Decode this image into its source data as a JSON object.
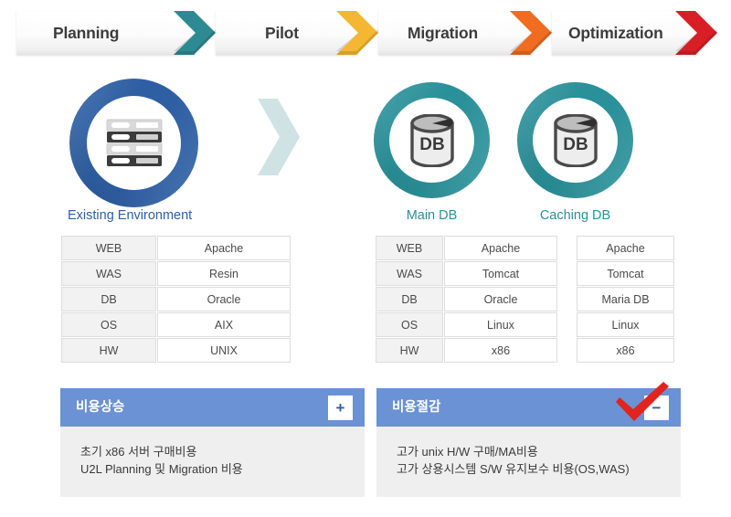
{
  "phases": [
    {
      "label": "Planning",
      "arrow_color": "#2e8a92"
    },
    {
      "label": "Pilot",
      "arrow_color": "#f5b731"
    },
    {
      "label": "Migration",
      "arrow_color": "#ef6c20"
    },
    {
      "label": "Optimization",
      "arrow_color": "#d81f26"
    }
  ],
  "nodes": {
    "existing": {
      "caption": "Existing Environment",
      "icon": "server-rack-icon",
      "ring_color": "#2e5fa3"
    },
    "main_db": {
      "caption": "Main DB",
      "icon": "database-icon",
      "badge_text": "DB",
      "ring_color": "#2a9099"
    },
    "caching_db": {
      "caption": "Caching DB",
      "icon": "database-icon",
      "badge_text": "DB",
      "ring_color": "#2a9099"
    }
  },
  "flow_arrow_icon": "chevron-right-icon",
  "tables": {
    "existing": {
      "rows": [
        {
          "key": "WEB",
          "value": "Apache"
        },
        {
          "key": "WAS",
          "value": "Resin"
        },
        {
          "key": "DB",
          "value": "Oracle"
        },
        {
          "key": "OS",
          "value": "AIX"
        },
        {
          "key": "HW",
          "value": "UNIX"
        }
      ]
    },
    "main_db": {
      "rows": [
        {
          "key": "WEB",
          "value": "Apache"
        },
        {
          "key": "WAS",
          "value": "Tomcat"
        },
        {
          "key": "DB",
          "value": "Oracle"
        },
        {
          "key": "OS",
          "value": "Linux"
        },
        {
          "key": "HW",
          "value": "x86"
        }
      ]
    },
    "caching_db": {
      "rows": [
        {
          "value": "Apache"
        },
        {
          "value": "Tomcat"
        },
        {
          "value": "Maria DB"
        },
        {
          "value": "Linux"
        },
        {
          "value": "x86"
        }
      ]
    }
  },
  "panels": {
    "cost_increase": {
      "title": "비용상승",
      "badge": "+",
      "lines": [
        "초기 x86 서버 구매비용",
        "U2L Planning 및 Migration 비용"
      ]
    },
    "cost_saving": {
      "title": "비용절감",
      "badge": "−",
      "check_icon": "check-mark-icon",
      "check_color": "#e3231e",
      "lines": [
        "고가 unix H/W 구매/MA비용",
        "고가 상용시스템 S/W 유지보수 비용(OS,WAS)"
      ]
    }
  },
  "colors": {
    "panel_header": "#6a92d4",
    "panel_body": "#efefef",
    "blue_ring": "#2e5fa3",
    "teal_ring": "#2a9099",
    "flow_chevron": "#cfe2e4"
  }
}
